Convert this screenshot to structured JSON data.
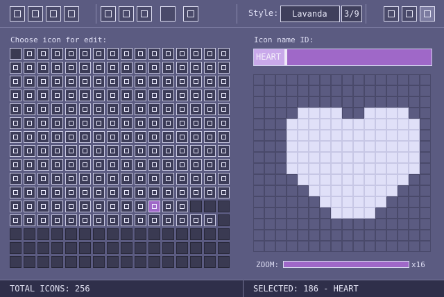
{
  "style_selector": {
    "label": "Style:",
    "current": "Lavanda",
    "index": "3/9"
  },
  "panels": {
    "choose_label": "Choose icon for edit:",
    "name_label": "Icon name ID:"
  },
  "name_input": {
    "value": "HEART"
  },
  "zoom": {
    "label": "ZOOM:",
    "value_label": "x16"
  },
  "status": {
    "total": "TOTAL ICONS: 256",
    "selected": "SELECTED: 186 - HEART"
  },
  "colors": {
    "background": "#5b5b81",
    "accent": "#9f68c8",
    "text": "#e4e4f4",
    "panel_dark": "#2f2f4a"
  },
  "toolbar_left": [
    "new-icon",
    "open-icon",
    "save-icon",
    "export-icon",
    "cut-icon",
    "copy-icon",
    "paste-icon",
    "blank-icon",
    "clear-icon"
  ],
  "toolbar_right": [
    "help-icon",
    "info-icon",
    "person-icon"
  ],
  "icon_grid": {
    "columns": 16,
    "rows": 16,
    "selected_index": 186
  },
  "heart_pixels": [
    "................",
    "................",
    "................",
    "....xxxx..xxxx..",
    "...xxxxxxxxxxxx.",
    "...xxxxxxxxxxxx.",
    "...xxxxxxxxxxxx.",
    "...xxxxxxxxxxxx.",
    "...xxxxxxxxxxxx.",
    "....xxxxxxxxxx..",
    ".....xxxxxxxx...",
    "......xxxxxx....",
    ".......xxxx.....",
    "................",
    "................",
    "................"
  ]
}
